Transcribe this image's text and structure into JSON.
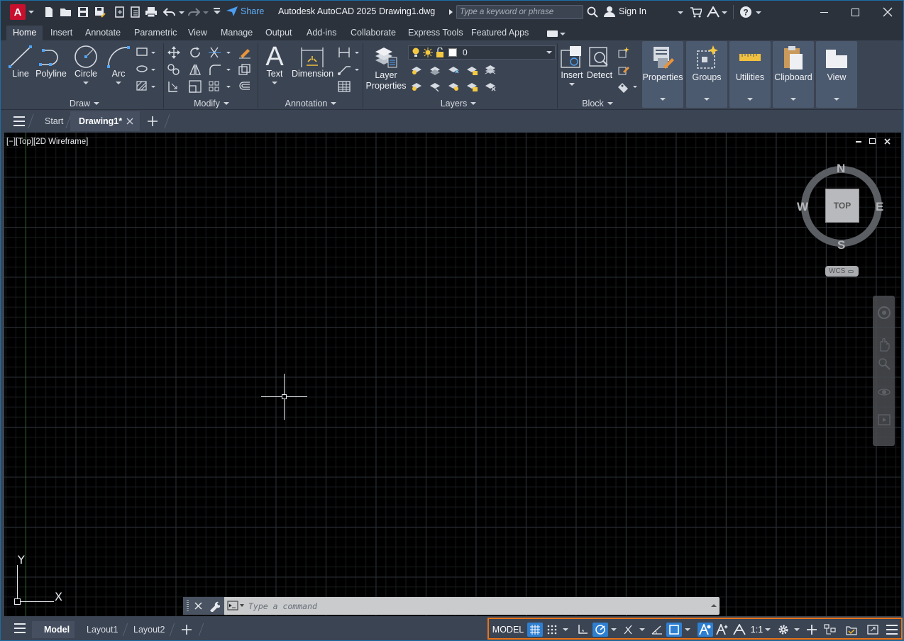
{
  "app": {
    "title": "Autodesk AutoCAD 2025",
    "file": "Drawing1.dwg",
    "logo_letter": "A"
  },
  "titlebar": {
    "share_label": "Share",
    "search_placeholder": "Type a keyword or phrase",
    "signin_label": "Sign In"
  },
  "ribbon_tabs": [
    "Home",
    "Insert",
    "Annotate",
    "Parametric",
    "View",
    "Manage",
    "Output",
    "Add-ins",
    "Collaborate",
    "Express Tools",
    "Featured Apps"
  ],
  "ribbon": {
    "draw": {
      "title": "Draw",
      "line": "Line",
      "polyline": "Polyline",
      "circle": "Circle",
      "arc": "Arc"
    },
    "modify": {
      "title": "Modify"
    },
    "annotation": {
      "title": "Annotation",
      "text": "Text",
      "dimension": "Dimension"
    },
    "layers": {
      "title": "Layers",
      "layer_properties_1": "Layer",
      "layer_properties_2": "Properties",
      "current_layer": "0"
    },
    "block": {
      "title": "Block",
      "insert": "Insert",
      "detect": "Detect"
    },
    "properties": "Properties",
    "groups": "Groups",
    "utilities": "Utilities",
    "clipboard": "Clipboard",
    "view": "View"
  },
  "file_tabs": {
    "start": "Start",
    "drawing": "Drawing1*"
  },
  "viewport": {
    "label": "[−][Top][2D Wireframe]",
    "viewcube": {
      "n": "N",
      "s": "S",
      "e": "E",
      "w": "W",
      "face": "TOP",
      "ucs": "WCS"
    },
    "ucs_x": "X",
    "ucs_y": "Y"
  },
  "command": {
    "placeholder": "Type a command"
  },
  "layout_tabs": [
    "Model",
    "Layout1",
    "Layout2"
  ],
  "status": {
    "model": "MODEL",
    "scale": "1:1"
  },
  "colors": {
    "accent": "#2f7fd1",
    "highlight_border": "#e8731a",
    "logo": "#c8102e"
  }
}
